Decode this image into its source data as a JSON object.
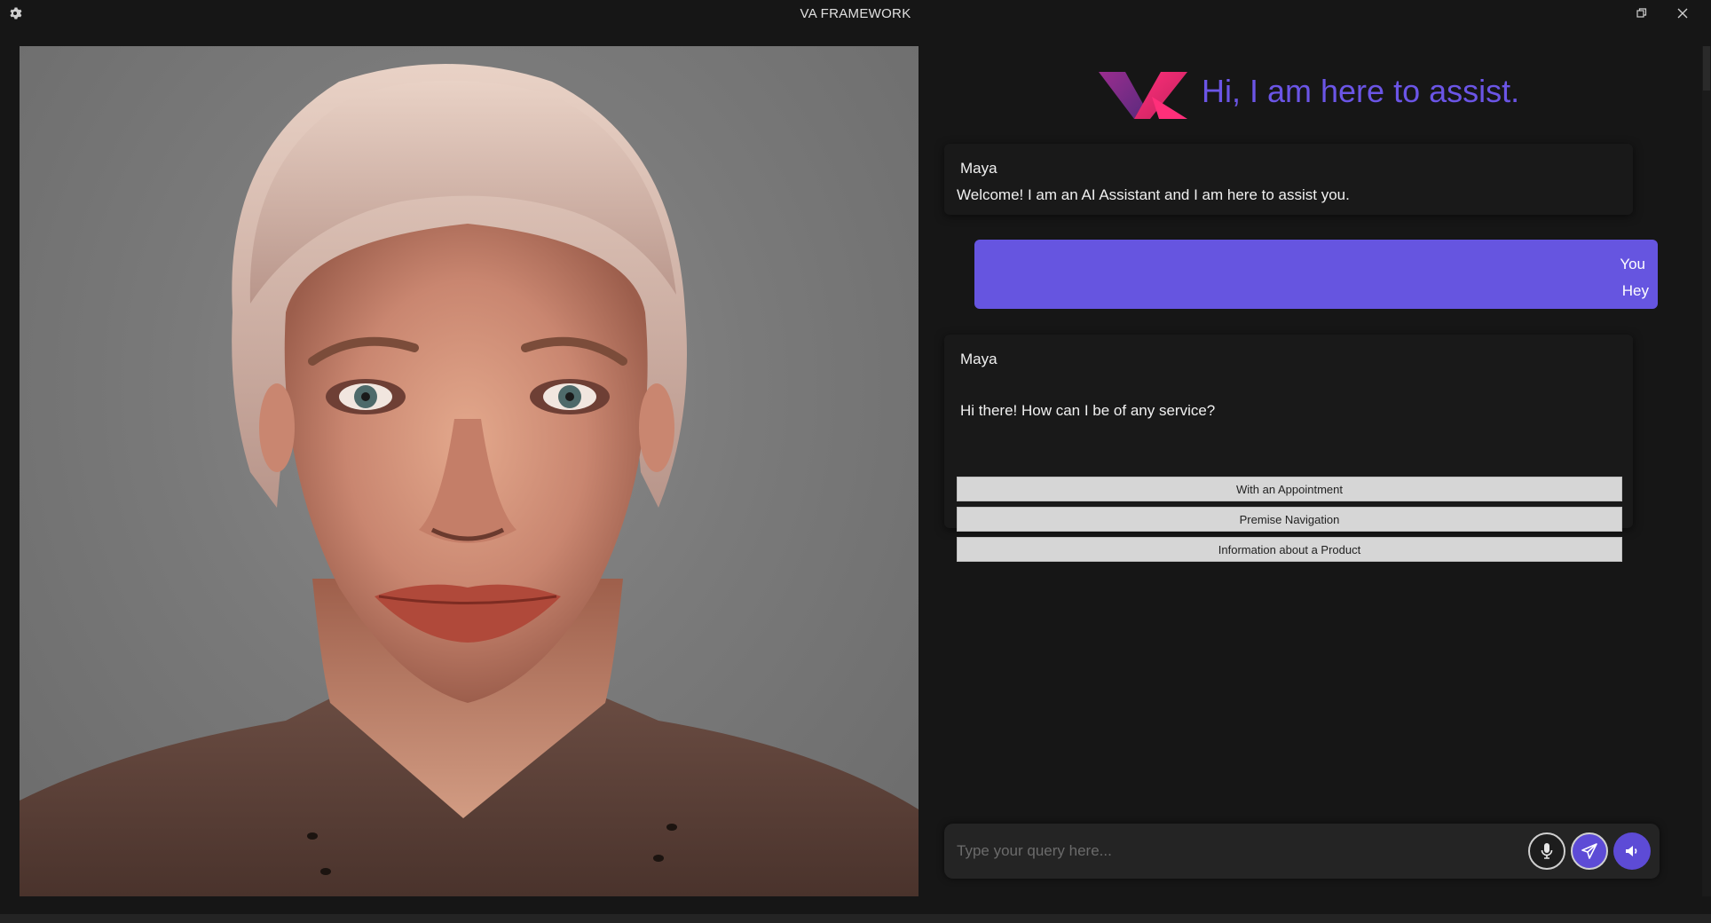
{
  "window": {
    "title": "VA FRAMEWORK",
    "icons": {
      "settings": "gear-icon",
      "restore": "restore-icon",
      "close": "close-icon"
    }
  },
  "avatar": {
    "description_icon": "avatar-render"
  },
  "header": {
    "greeting": "Hi, I am here to assist.",
    "brand_color": "#6b55e6"
  },
  "messages": [
    {
      "sender": "Maya",
      "text": "Welcome! I am an AI Assistant and I am here to assist you."
    },
    {
      "sender": "You",
      "text": "Hey"
    },
    {
      "sender": "Maya",
      "text": "Hi there! How can I be of any service?",
      "options": [
        "With an Appointment",
        "Premise Navigation",
        "Information about a Product"
      ]
    }
  ],
  "input": {
    "placeholder": "Type your query here...",
    "value": ""
  },
  "controls": {
    "mic": "microphone-icon",
    "send": "send-icon",
    "sound": "speaker-icon"
  },
  "colors": {
    "background": "#161616",
    "user_bubble": "#6655e0",
    "bot_card": "#191919",
    "accent": "#5d4bd6"
  }
}
